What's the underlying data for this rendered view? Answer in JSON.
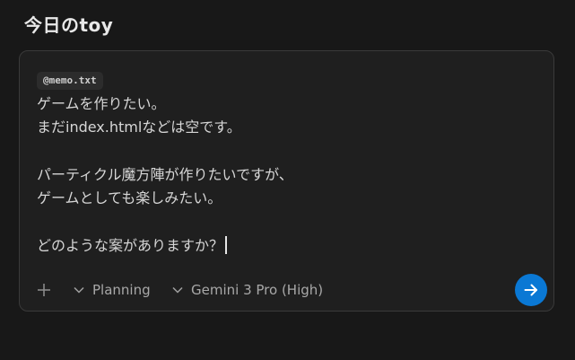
{
  "header": {
    "title": "今日のtoy"
  },
  "composer": {
    "attachment_chip": "@memo.txt",
    "lines": [
      "ゲームを作りたい。",
      "まだindex.htmlなどは空です。",
      "",
      "パーティクル魔方陣が作りたいですが、",
      "ゲームとしても楽しみたい。",
      "",
      "どのような案がありますか？"
    ]
  },
  "toolbar": {
    "add_icon": "plus-icon",
    "mode_label": "Planning",
    "model_label": "Gemini 3 Pro (High)",
    "send_icon": "arrow-right-icon"
  },
  "colors": {
    "background": "#181818",
    "panel": "#1f1f1f",
    "border": "#3a3a3a",
    "accent": "#0a78d4"
  }
}
